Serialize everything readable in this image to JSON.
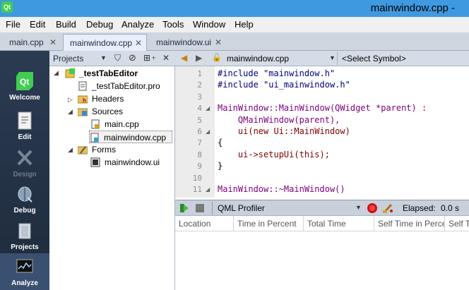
{
  "window": {
    "title": "mainwindow.cpp - Qt Creator",
    "title_visible": "mainwindow.cpp - ",
    "app_icon": "qt-logo"
  },
  "menu": [
    "File",
    "Edit",
    "Build",
    "Debug",
    "Analyze",
    "Tools",
    "Window",
    "Help"
  ],
  "tabs": [
    {
      "label": "main.cpp",
      "active": false
    },
    {
      "label": "mainwindow.cpp",
      "active": true
    },
    {
      "label": "mainwindow.ui",
      "active": false
    }
  ],
  "modes": [
    {
      "label": "Welcome",
      "icon": "qt-logo-icon",
      "state": "normal"
    },
    {
      "label": "Edit",
      "icon": "document-icon",
      "state": "normal"
    },
    {
      "label": "Design",
      "icon": "design-tools-icon",
      "state": "disabled"
    },
    {
      "label": "Debug",
      "icon": "bug-icon",
      "state": "normal"
    },
    {
      "label": "Projects",
      "icon": "folder-icon",
      "state": "normal"
    },
    {
      "label": "Analyze",
      "icon": "monitor-icon",
      "state": "active"
    }
  ],
  "projects": {
    "header": "Projects",
    "tree": [
      {
        "label": "_testTabEditor",
        "icon": "project-icon",
        "bold": true,
        "expanded": true
      },
      {
        "label": "_testTabEditor.pro",
        "icon": "pro-file-icon"
      },
      {
        "label": "Headers",
        "icon": "headers-folder-icon",
        "expanded": false
      },
      {
        "label": "Sources",
        "icon": "sources-folder-icon",
        "expanded": true
      },
      {
        "label": "main.cpp",
        "icon": "cpp-file-icon"
      },
      {
        "label": "mainwindow.cpp",
        "icon": "cpp-file-icon",
        "selected": true
      },
      {
        "label": "Forms",
        "icon": "forms-folder-icon",
        "expanded": true
      },
      {
        "label": "mainwindow.ui",
        "icon": "ui-file-icon"
      }
    ]
  },
  "editor": {
    "current_file": "mainwindow.cpp",
    "symbol": "<Select Symbol>",
    "lines": [
      {
        "n": "1",
        "text": "#include \"mainwindow.h\"",
        "color": "#000080"
      },
      {
        "n": "2",
        "text": "#include \"ui_mainwindow.h\"",
        "color": "#000080"
      },
      {
        "n": "3",
        "text": "",
        "color": "#000000"
      },
      {
        "n": "4",
        "text": "MainWindow::MainWindow(QWidget *parent) :",
        "color": "#800080"
      },
      {
        "n": "5",
        "text": "    QMainWindow(parent),",
        "color": "#800080"
      },
      {
        "n": "6",
        "text": "    ui(new Ui::MainWindow)",
        "color": "#800000"
      },
      {
        "n": "7",
        "text": "{",
        "color": "#000000"
      },
      {
        "n": "8",
        "text": "    ui->setupUi(this);",
        "color": "#800000"
      },
      {
        "n": "9",
        "text": "}",
        "color": "#000000"
      },
      {
        "n": "10",
        "text": "",
        "color": "#000000"
      },
      {
        "n": "11",
        "text": "MainWindow::~MainWindow()",
        "color": "#800080"
      }
    ]
  },
  "profiler": {
    "title": "QML Profiler",
    "elapsed_label": "Elapsed:",
    "elapsed_value": "0.0 s",
    "columns": [
      "Location",
      "Time in Percent",
      "Total Time",
      "Self Time in Perce",
      "Self T"
    ]
  },
  "colors": {
    "sidebar_top": "#2b3b52",
    "titlebar": "#3f99e0",
    "qt_green": "#41cd52",
    "record_red": "#d01010"
  }
}
